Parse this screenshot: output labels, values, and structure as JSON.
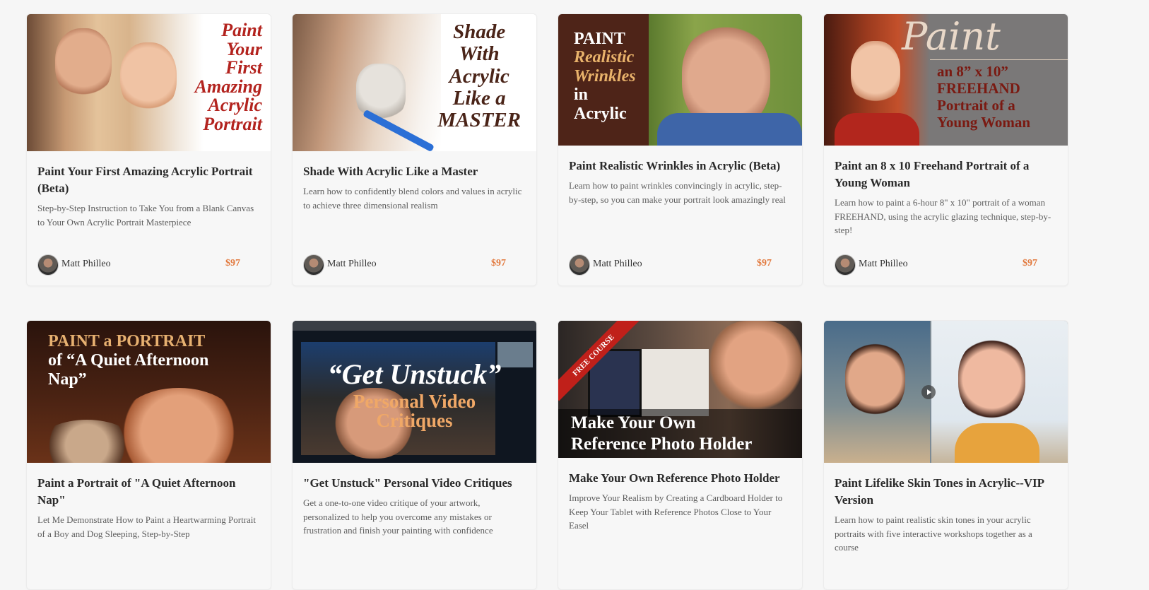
{
  "courses": [
    {
      "thumb_text": [
        "Paint",
        "Your",
        "First",
        "Amazing",
        "Acrylic",
        "Portrait"
      ],
      "title": "Paint Your First Amazing Acrylic Portrait (Beta)",
      "description": "Step-by-Step Instruction to Take You from a Blank Canvas to Your Own Acrylic Portrait Masterpiece",
      "author": "Matt Philleo",
      "price": "$97"
    },
    {
      "thumb_text": [
        "Shade",
        "With",
        "Acrylic",
        "Like a",
        "MASTER"
      ],
      "title": "Shade With Acrylic Like a Master",
      "description": "Learn how to confidently blend colors and values in acrylic to achieve three dimensional realism",
      "author": "Matt Philleo",
      "price": "$97"
    },
    {
      "thumb_text": [
        "PAINT",
        "Realistic",
        "Wrinkles",
        "in",
        "Acrylic"
      ],
      "title": "Paint Realistic Wrinkles in Acrylic (Beta)",
      "description": "Learn how to paint wrinkles convincingly in acrylic, step-by-step, so you can make your portrait look amazingly real",
      "author": "Matt Philleo",
      "price": "$97"
    },
    {
      "thumb_text": [
        "Paint",
        "an 8” x 10”",
        "FREEHAND",
        "Portrait of a",
        "Young Woman"
      ],
      "title": "Paint an 8 x 10 Freehand Portrait of a Young Woman",
      "description": "Learn how to paint a 6-hour 8\" x 10\" portrait of a woman FREEHAND, using the acrylic glazing technique, step-by-step!",
      "author": "Matt Philleo",
      "price": "$97"
    },
    {
      "thumb_text": [
        "PAINT a PORTRAIT",
        "of “A Quiet Afternoon",
        "Nap”"
      ],
      "title": "Paint a Portrait of \"A Quiet Afternoon Nap\"",
      "description": "Let Me Demonstrate How to Paint a Heartwarming Portrait of a Boy and Dog Sleeping, Step-by-Step"
    },
    {
      "thumb_text": [
        "“Get Unstuck”",
        "Personal Video",
        "Critiques"
      ],
      "title": "\"Get Unstuck\" Personal Video Critiques",
      "description": "Get a one-to-one video critique of your artwork, personalized to help you overcome any mistakes or frustration and finish your painting with confidence"
    },
    {
      "thumb_text": [
        "FREE COURSE",
        "Make Your Own",
        "Reference Photo Holder"
      ],
      "title": "Make Your Own Reference Photo Holder",
      "description": "Improve Your Realism by Creating a Cardboard Holder to Keep Your Tablet with Reference Photos Close to Your Easel"
    },
    {
      "thumb_text": [],
      "title": "Paint Lifelike Skin Tones in Acrylic--VIP Version",
      "description": "Learn how to paint realistic skin tones in your acrylic portraits with five interactive workshops together as a course"
    }
  ],
  "colors": {
    "price": "#e27a3f",
    "title": "#2a2a2a",
    "description": "#5d5d5d",
    "background": "#f6f6f6"
  },
  "icons": [
    "play-icon"
  ]
}
